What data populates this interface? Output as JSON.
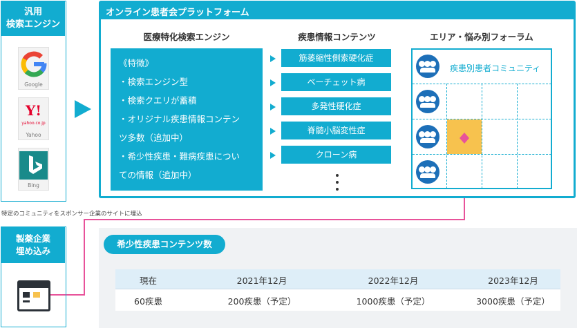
{
  "left_panel": {
    "title_line1": "汎用",
    "title_line2": "検索エンジン",
    "engines": [
      {
        "caption": "Google"
      },
      {
        "caption": "Yahoo"
      },
      {
        "caption": "Bing"
      }
    ],
    "yahoo_logo_text": "Y!",
    "yahoo_sub": "yahoo.co.jp"
  },
  "platform": {
    "title": "オンライン患者会プラットフォーム",
    "col1_title": "医療特化検索エンジン",
    "col2_title": "疾患情報コンテンツ",
    "col3_title": "エリア・悩み別フォーラム",
    "features": [
      "《特徴》",
      "・検索エンジン型",
      "・検索クエリが蓄積",
      "・オリジナル疾患情報コンテン",
      "ツ多数（追加中）",
      "・希少性疾患・難病疾患につい",
      "ての情報（追加中）"
    ],
    "topics": [
      "筋萎縮性側索硬化症",
      "ベーチェット病",
      "多発性硬化症",
      "脊髄小脳変性症",
      "クローン病"
    ],
    "forum_label": "疾患別患者コミュニティ"
  },
  "note": "特定のコミュニティをスポンサー企業のサイトに埋込",
  "embed": {
    "title_line1": "製薬企業",
    "title_line2": "埋め込み"
  },
  "rare": {
    "title": "希少性疾患コンテンツ数",
    "headers": [
      "現在",
      "2021年12月",
      "2022年12月",
      "2023年12月"
    ],
    "values": [
      "60疾患",
      "200疾患（予定）",
      "1000疾患（予定）",
      "3000疾患（予定）"
    ]
  },
  "colors": {
    "accent": "#12acd0",
    "highlight": "#f7c24e",
    "link_line": "#e8529a"
  }
}
